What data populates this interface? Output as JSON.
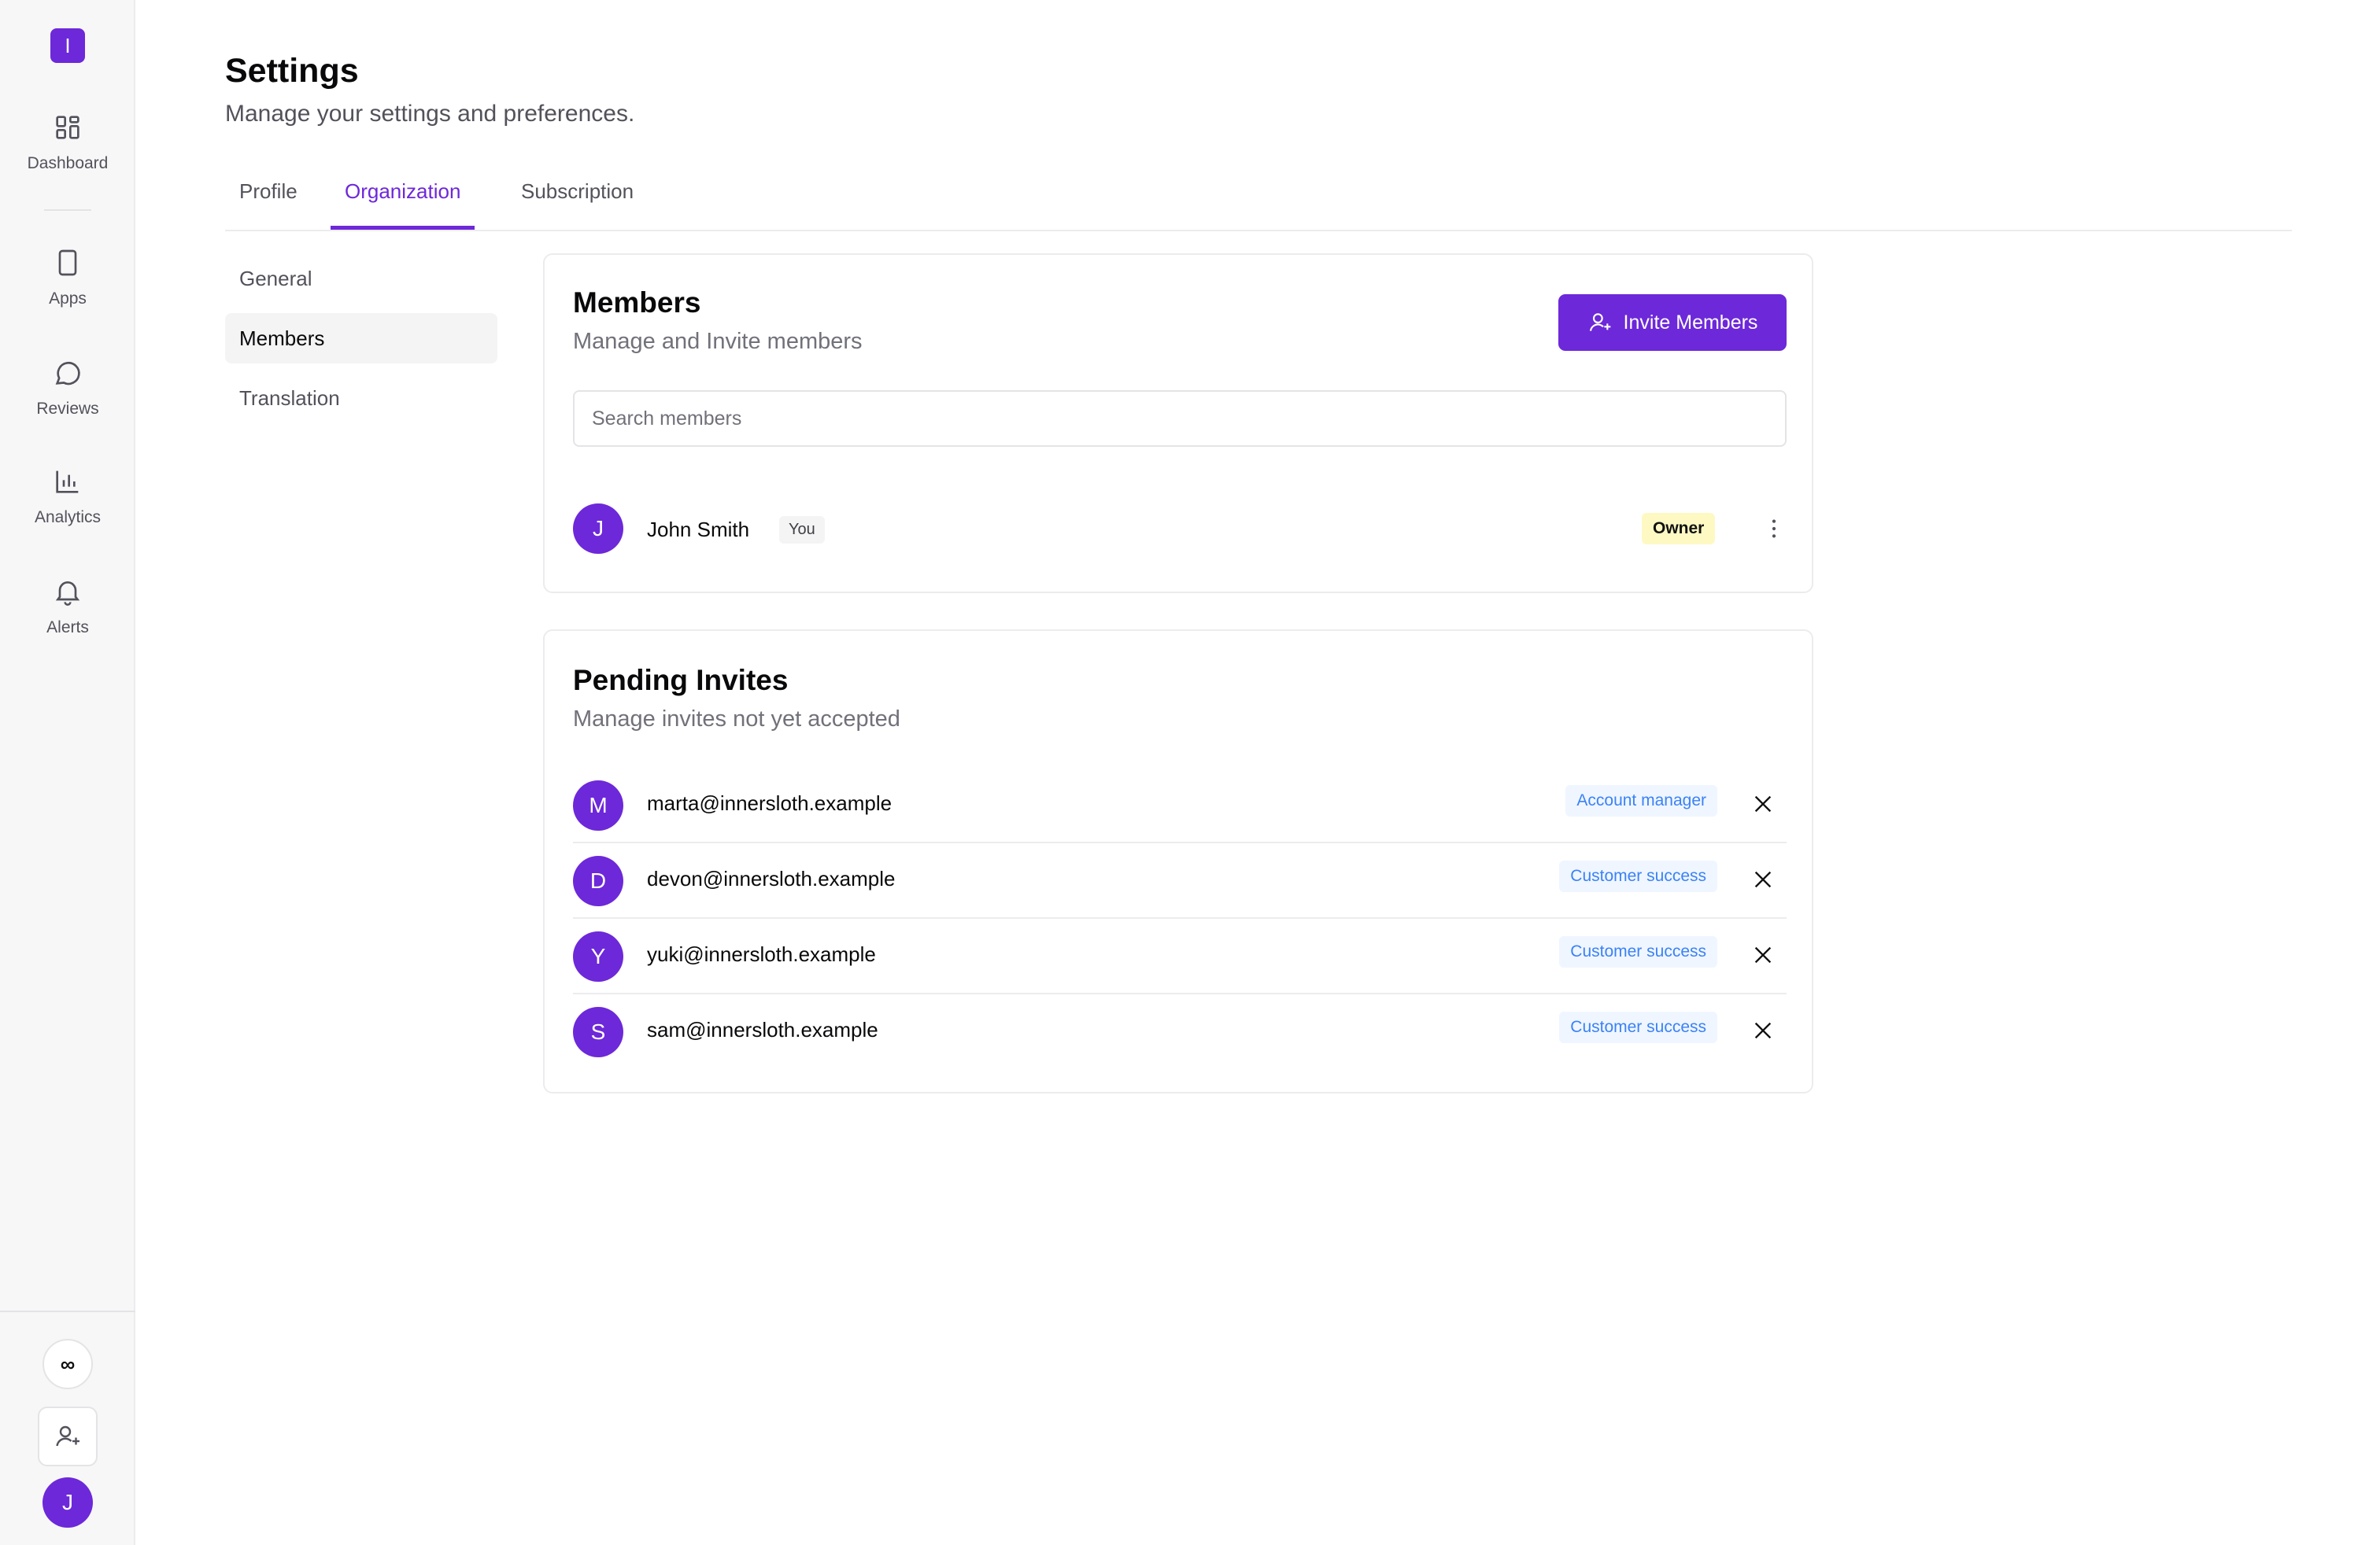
{
  "sidebar": {
    "brand_letter": "I",
    "nav": [
      {
        "label": "Dashboard",
        "icon": "layout-grid-icon"
      },
      {
        "label": "Apps",
        "icon": "smartphone-icon"
      },
      {
        "label": "Reviews",
        "icon": "message-circle-icon"
      },
      {
        "label": "Analytics",
        "icon": "bar-chart-icon"
      },
      {
        "label": "Alerts",
        "icon": "bell-icon"
      }
    ],
    "infinity_symbol": "∞",
    "user_initial": "J"
  },
  "header": {
    "title": "Settings",
    "subtitle": "Manage your settings and preferences."
  },
  "tabs": [
    {
      "label": "Profile",
      "active": false
    },
    {
      "label": "Organization",
      "active": true
    },
    {
      "label": "Subscription",
      "active": false
    }
  ],
  "subnav": [
    {
      "label": "General",
      "active": false
    },
    {
      "label": "Members",
      "active": true
    },
    {
      "label": "Translation",
      "active": false
    }
  ],
  "members_card": {
    "title": "Members",
    "description": "Manage and Invite members",
    "invite_button": "Invite Members",
    "search_placeholder": "Search members",
    "members": [
      {
        "initial": "J",
        "name": "John Smith",
        "you_badge": "You",
        "role": "Owner"
      }
    ]
  },
  "invites_card": {
    "title": "Pending Invites",
    "description": "Manage invites not yet accepted",
    "invites": [
      {
        "initial": "M",
        "email": "marta@innersloth.example",
        "role": "Account manager"
      },
      {
        "initial": "D",
        "email": "devon@innersloth.example",
        "role": "Customer success"
      },
      {
        "initial": "Y",
        "email": "yuki@innersloth.example",
        "role": "Customer success"
      },
      {
        "initial": "S",
        "email": "sam@innersloth.example",
        "role": "Customer success"
      }
    ]
  },
  "colors": {
    "accent": "#6d28d9",
    "owner_badge_bg": "#fef9c3",
    "role_badge_bg": "#eff6ff",
    "role_badge_text": "#3b82f6"
  }
}
